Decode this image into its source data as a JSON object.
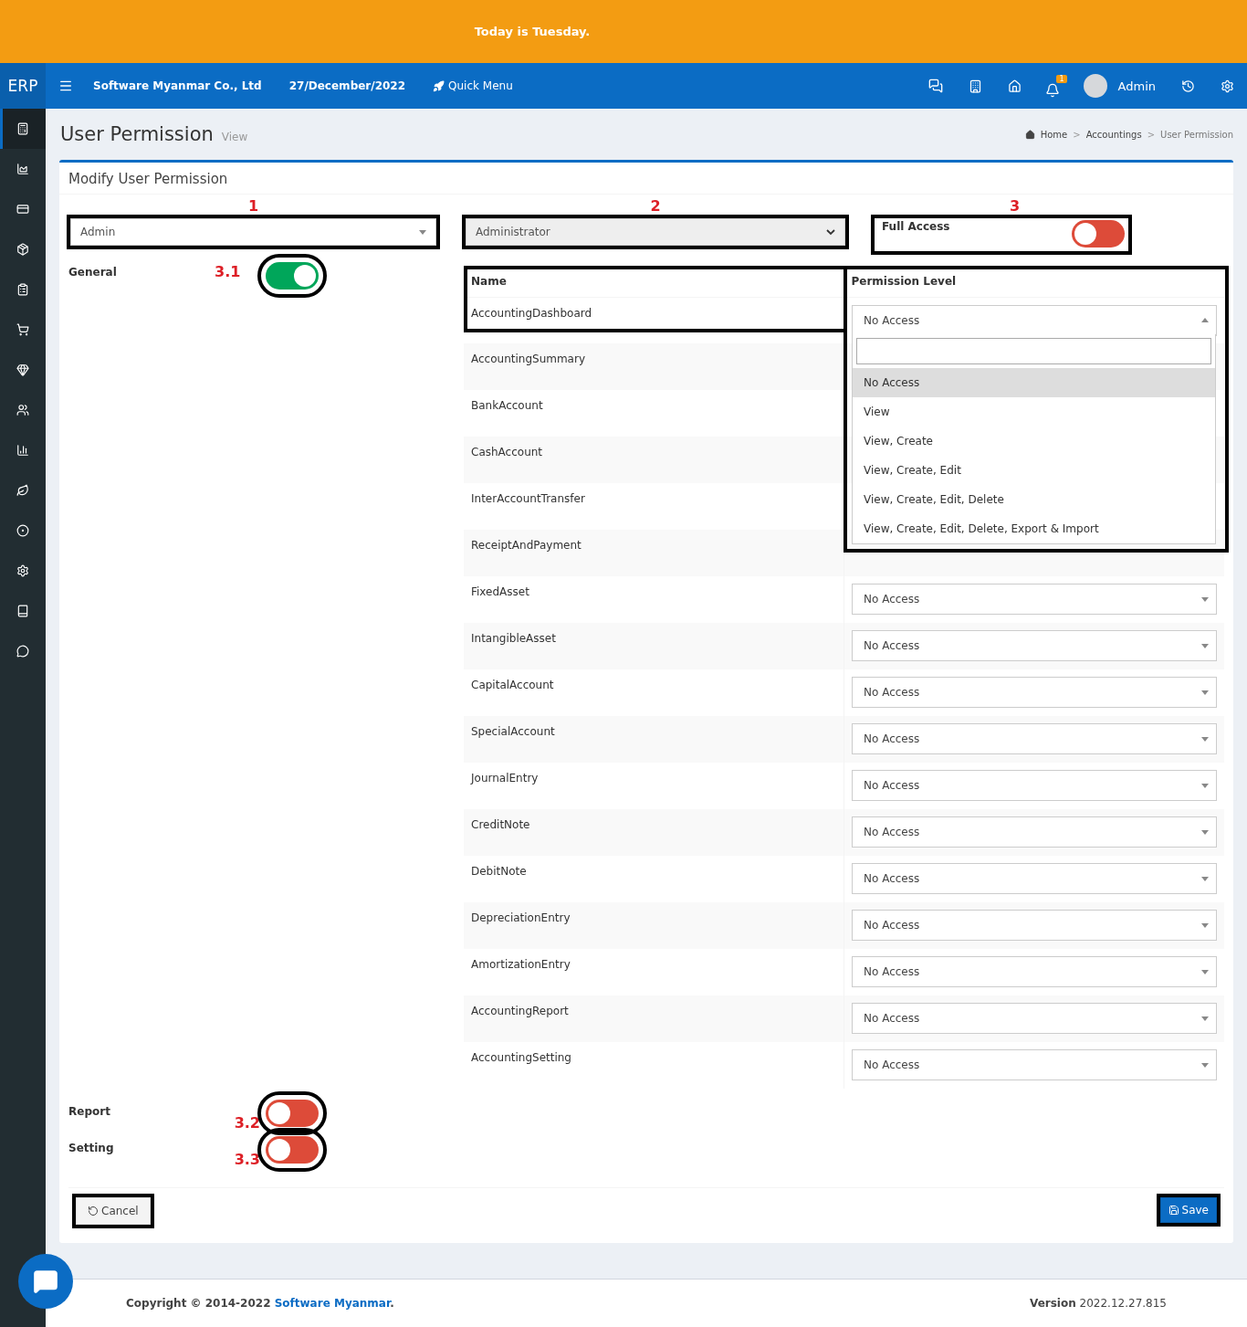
{
  "banner": {
    "text": "Today is Tuesday."
  },
  "navbar": {
    "logo": "ERP",
    "company": "Software Myanmar Co., Ltd",
    "date": "27/December/2022",
    "quick_menu": "Quick Menu",
    "notification_count": "1",
    "user": "Admin"
  },
  "sidebar": {
    "items": [
      {
        "selected": true
      },
      {
        "selected": false
      },
      {
        "selected": false
      },
      {
        "selected": false
      },
      {
        "selected": false
      },
      {
        "selected": false
      },
      {
        "selected": false
      },
      {
        "selected": false
      },
      {
        "selected": false
      },
      {
        "selected": false
      },
      {
        "selected": false
      },
      {
        "selected": false
      },
      {
        "selected": false
      },
      {
        "selected": false
      }
    ]
  },
  "page": {
    "title": "User Permission",
    "subtitle": "View",
    "breadcrumb": [
      {
        "label": "Home"
      },
      {
        "separator": ">",
        "label": "Accountings"
      },
      {
        "separator": ">",
        "label": "User Permission"
      }
    ]
  },
  "form": {
    "title": "Modify User Permission",
    "user_select": {
      "value": "Admin",
      "marker": "1"
    },
    "role_select": {
      "value": "Administrator",
      "marker": "2"
    },
    "full_access": {
      "label": "Full Access",
      "on": false,
      "marker": "3"
    },
    "sections": [
      {
        "label": "General",
        "on": true,
        "marker": "3.1"
      },
      {
        "label": "Report",
        "on": false,
        "marker": "3.2"
      },
      {
        "label": "Setting",
        "on": false,
        "marker": "3.3"
      }
    ]
  },
  "table": {
    "columns": [
      "Name",
      "Permission Level"
    ],
    "rows": [
      {
        "name": "AccountingDashboard",
        "permission": "No Access",
        "open": true
      },
      {
        "name": "AccountingSummary"
      },
      {
        "name": "BankAccount"
      },
      {
        "name": "CashAccount"
      },
      {
        "name": "InterAccountTransfer"
      },
      {
        "name": "ReceiptAndPayment"
      },
      {
        "name": "FixedAsset",
        "permission": "No Access",
        "open": false
      },
      {
        "name": "IntangibleAsset",
        "permission": "No Access",
        "open": false
      },
      {
        "name": "CapitalAccount",
        "permission": "No Access",
        "open": false
      },
      {
        "name": "SpecialAccount",
        "permission": "No Access",
        "open": false
      },
      {
        "name": "JournalEntry",
        "permission": "No Access",
        "open": false
      },
      {
        "name": "CreditNote",
        "permission": "No Access",
        "open": false
      },
      {
        "name": "DebitNote",
        "permission": "No Access",
        "open": false
      },
      {
        "name": "DepreciationEntry",
        "permission": "No Access",
        "open": false
      },
      {
        "name": "AmortizationEntry",
        "permission": "No Access",
        "open": false
      },
      {
        "name": "AccountingReport",
        "permission": "No Access",
        "open": false
      },
      {
        "name": "AccountingSetting",
        "permission": "No Access",
        "open": false
      }
    ]
  },
  "dropdown": {
    "options": [
      {
        "label": "No Access",
        "selected": true
      },
      {
        "label": "View",
        "selected": false
      },
      {
        "label": "View, Create",
        "selected": false
      },
      {
        "label": "View, Create, Edit",
        "selected": false
      },
      {
        "label": "View, Create, Edit, Delete",
        "selected": false
      },
      {
        "label": "View, Create, Edit, Delete, Export & Import",
        "selected": false
      }
    ]
  },
  "buttons": {
    "cancel": "Cancel",
    "save": "Save"
  },
  "footer": {
    "copyright": "Copyright © 2014-2022 ",
    "company": "Software Myanmar",
    "copyright_end": ".",
    "version_label": "Version",
    "version": "2022.12.27.815"
  }
}
